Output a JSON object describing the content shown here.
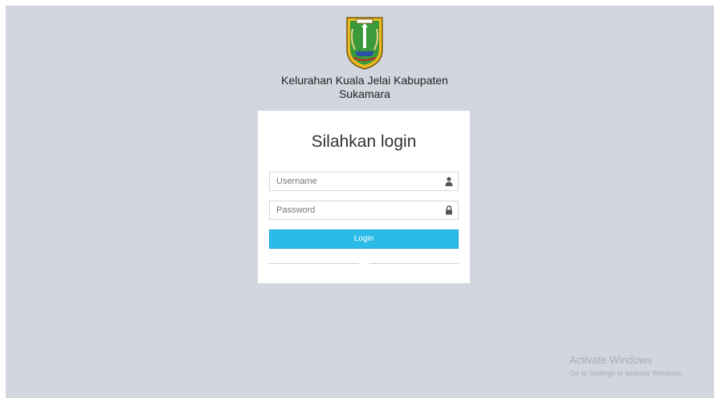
{
  "organization": {
    "name_line1": "Kelurahan Kuala Jelai Kabupaten",
    "name_line2": "Sukamara"
  },
  "login": {
    "title": "Silahkan login",
    "username_placeholder": "Username",
    "password_placeholder": "Password",
    "button_label": "Login"
  },
  "icons": {
    "username": "user-icon",
    "password": "lock-icon",
    "logo": "regency-emblem-logo"
  },
  "colors": {
    "background": "#d2d6de",
    "button": "#2bbbe8",
    "logo_green": "#3a9a3a",
    "logo_gold": "#e8b923"
  },
  "watermark": {
    "title": "Activate Windows",
    "subtitle": "Go to Settings to activate Windows."
  }
}
